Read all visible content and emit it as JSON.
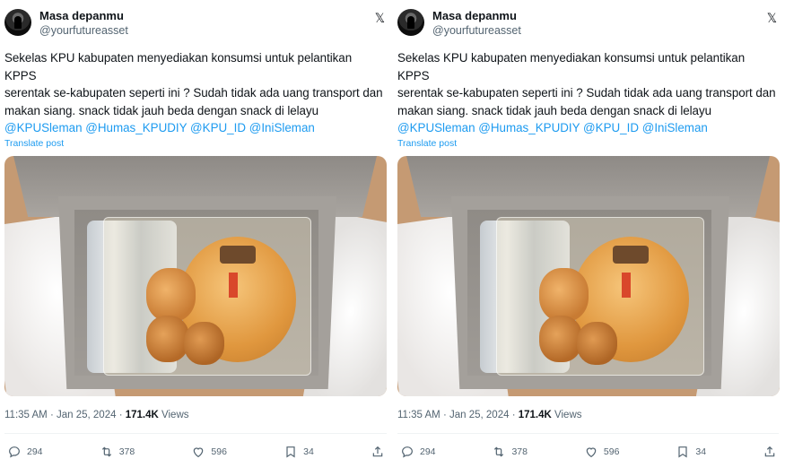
{
  "tweets": [
    {
      "author": {
        "display_name": "Masa depanmu",
        "handle": "@yourfutureasset"
      },
      "body": "Sekelas KPU kabupaten menyediakan konsumsi untuk pelantikan KPPS\nserentak se-kabupaten seperti ini ? Sudah tidak ada uang transport dan\nmakan siang. snack tidak jauh beda dengan snack di lelayu",
      "mentions": "@KPUSleman @Humas_KPUDIY @KPU_ID @IniSleman",
      "translate_label": "Translate post",
      "time": "11:35 AM",
      "date": "Jan 25, 2024",
      "views_count": "171.4K",
      "views_label": "Views",
      "replies": "294",
      "reposts": "378",
      "likes": "596",
      "bookmarks": "34"
    },
    {
      "author": {
        "display_name": "Masa depanmu",
        "handle": "@yourfutureasset"
      },
      "body": "Sekelas KPU kabupaten menyediakan konsumsi untuk pelantikan KPPS\nserentak se-kabupaten seperti ini ? Sudah tidak ada uang transport dan\nmakan siang. snack tidak jauh beda dengan snack di lelayu",
      "mentions": "@KPUSleman @Humas_KPUDIY @KPU_ID @IniSleman",
      "translate_label": "Translate post",
      "time": "11:35 AM",
      "date": "Jan 25, 2024",
      "views_count": "171.4K",
      "views_label": "Views",
      "replies": "294",
      "reposts": "378",
      "likes": "596",
      "bookmarks": "34"
    }
  ],
  "colors": {
    "link": "#1d9bf0",
    "muted": "#536471",
    "text": "#0f1419"
  },
  "icons": [
    "x-logo-icon",
    "reply-icon",
    "repost-icon",
    "like-icon",
    "bookmark-icon",
    "share-icon"
  ]
}
